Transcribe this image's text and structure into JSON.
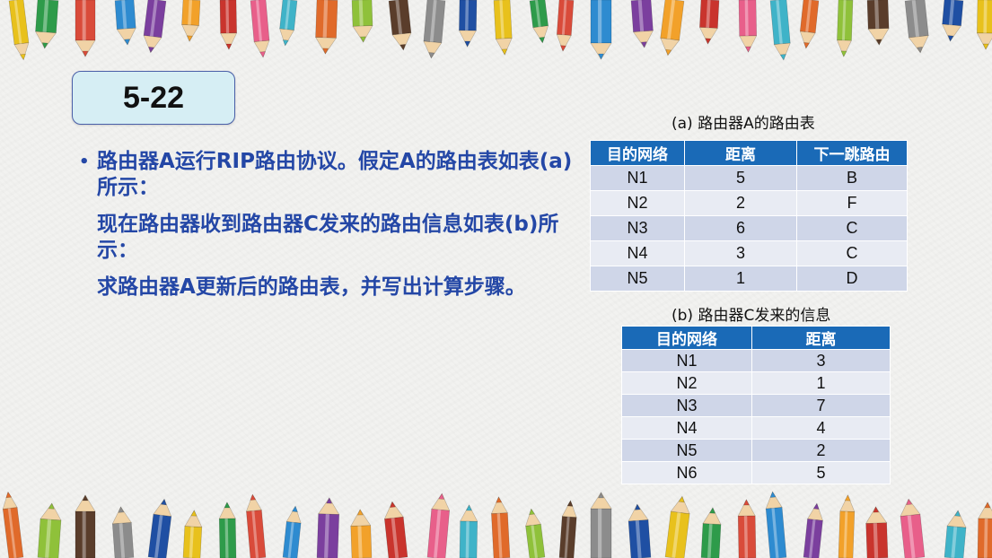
{
  "slide": {
    "number": "5-22",
    "bullet_symbol": "•",
    "question_lines": [
      "路由器A运行RIP路由协议。假定A的路由表如表(a)所示：",
      "现在路由器收到路由器C发来的路由信息如表(b)所示：",
      "求路由器A更新后的路由表，并写出计算步骤。"
    ]
  },
  "table_a": {
    "caption": "(a) 路由器A的路由表",
    "headers": [
      "目的网络",
      "距离",
      "下一跳路由"
    ],
    "rows": [
      [
        "N1",
        "5",
        "B"
      ],
      [
        "N2",
        "2",
        "F"
      ],
      [
        "N3",
        "6",
        "C"
      ],
      [
        "N4",
        "3",
        "C"
      ],
      [
        "N5",
        "1",
        "D"
      ]
    ]
  },
  "table_b": {
    "caption": "(b) 路由器C发来的信息",
    "headers": [
      "目的网络",
      "距离"
    ],
    "rows": [
      [
        "N1",
        "3"
      ],
      [
        "N2",
        "1"
      ],
      [
        "N3",
        "7"
      ],
      [
        "N4",
        "4"
      ],
      [
        "N5",
        "2"
      ],
      [
        "N6",
        "5"
      ]
    ]
  },
  "decoration": {
    "pencil_colors": [
      "#e8c11c",
      "#2e8bd0",
      "#c9342d",
      "#e06a2a",
      "#8c8c8c",
      "#2e9b4a",
      "#7b3f9e",
      "#e85f8a",
      "#8fc13a",
      "#1f4fa3",
      "#d94b3a",
      "#f2a12a",
      "#3fb3c8",
      "#5a3d2b"
    ]
  }
}
